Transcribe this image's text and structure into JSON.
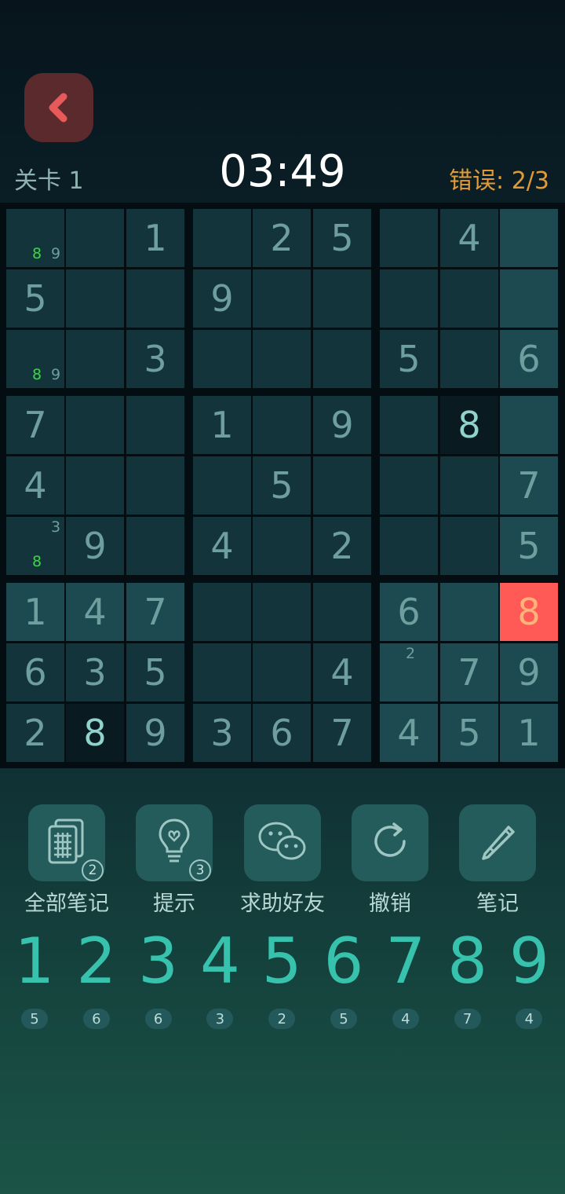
{
  "header": {
    "level": "关卡 1",
    "timer": "03:49",
    "errors": "错误: 2/3"
  },
  "board": {
    "rows": [
      [
        "",
        "",
        "1",
        "",
        "2",
        "5",
        "",
        "4",
        ""
      ],
      [
        "5",
        "",
        "",
        "9",
        "",
        "",
        "",
        "",
        ""
      ],
      [
        "",
        "",
        "3",
        "",
        "",
        "",
        "5",
        "",
        "6"
      ],
      [
        "7",
        "",
        "",
        "1",
        "",
        "9",
        "",
        "8",
        ""
      ],
      [
        "4",
        "",
        "",
        "",
        "5",
        "",
        "",
        "",
        "7"
      ],
      [
        "",
        "9",
        "",
        "4",
        "",
        "2",
        "",
        "",
        "5"
      ],
      [
        "1",
        "4",
        "7",
        "",
        "",
        "",
        "6",
        "",
        "8"
      ],
      [
        "6",
        "3",
        "5",
        "",
        "",
        "4",
        "",
        "7",
        "9"
      ],
      [
        "2",
        "8",
        "9",
        "3",
        "6",
        "7",
        "4",
        "5",
        "1"
      ]
    ],
    "notes": [
      {
        "r": 0,
        "c": 0,
        "digits": [
          "8",
          "9"
        ]
      },
      {
        "r": 2,
        "c": 0,
        "digits": [
          "8",
          "9"
        ]
      },
      {
        "r": 5,
        "c": 0,
        "digits": [
          "3",
          "8"
        ]
      },
      {
        "r": 7,
        "c": 6,
        "digits": [
          "2"
        ]
      }
    ],
    "error_color": "#ff5a55",
    "note_highlight_color": "#3ed34a"
  },
  "tools": [
    {
      "label": "全部笔记",
      "icon": "all-notes-icon",
      "badge": "2"
    },
    {
      "label": "提示",
      "icon": "lightbulb-icon",
      "badge": "3"
    },
    {
      "label": "求助好友",
      "icon": "wechat-icon",
      "badge": ""
    },
    {
      "label": "撤销",
      "icon": "undo-icon",
      "badge": ""
    },
    {
      "label": "笔记",
      "icon": "pencil-icon",
      "badge": ""
    }
  ],
  "numpad": [
    {
      "digit": "1",
      "count": "5"
    },
    {
      "digit": "2",
      "count": "6"
    },
    {
      "digit": "3",
      "count": "6"
    },
    {
      "digit": "4",
      "count": "3"
    },
    {
      "digit": "5",
      "count": "2"
    },
    {
      "digit": "6",
      "count": "5"
    },
    {
      "digit": "7",
      "count": "4"
    },
    {
      "digit": "8",
      "count": "7"
    },
    {
      "digit": "9",
      "count": "4"
    }
  ],
  "accent_color": "#36c2ac"
}
